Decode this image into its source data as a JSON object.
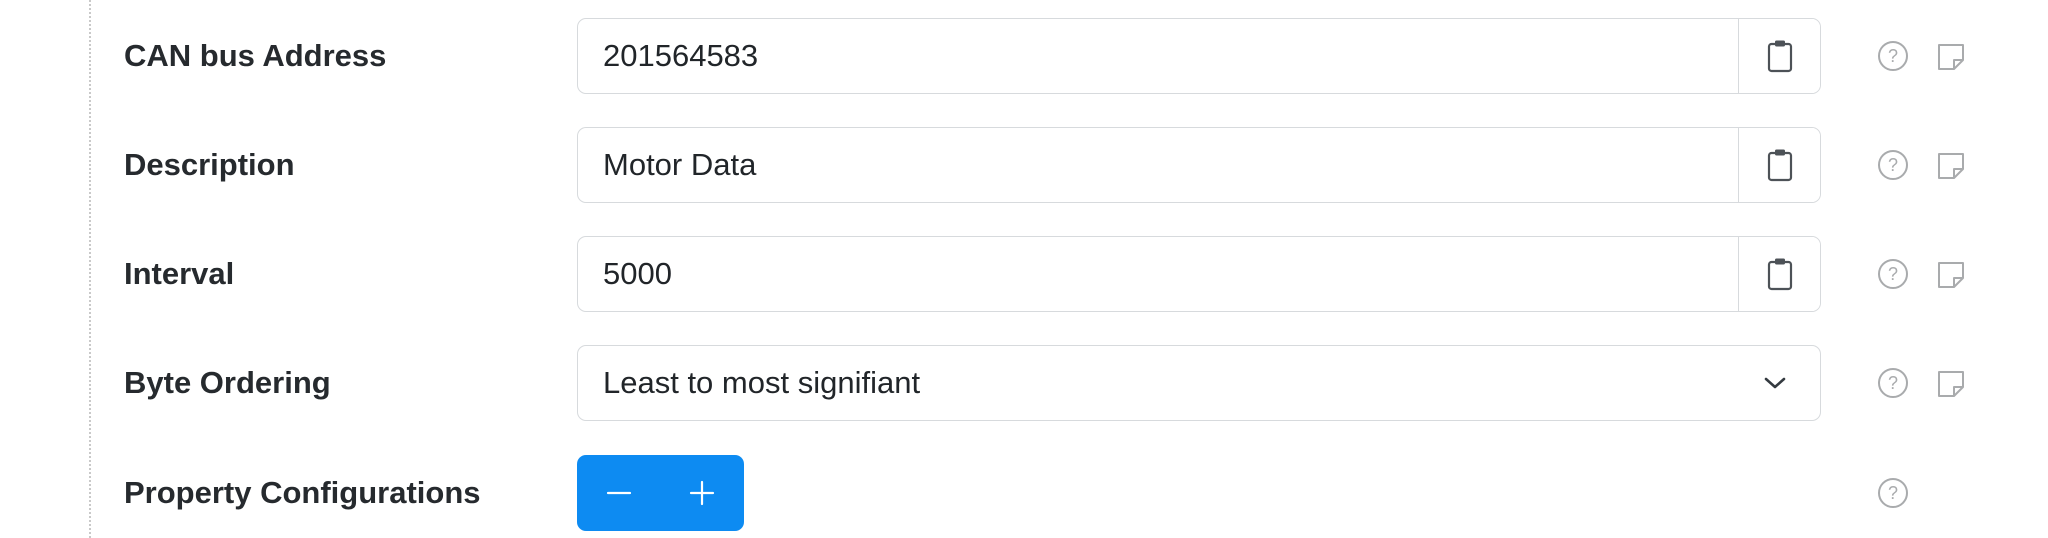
{
  "form": {
    "fields": [
      {
        "label": "CAN bus Address",
        "value": "201564583",
        "control": "text-with-clipboard"
      },
      {
        "label": "Description",
        "value": "Motor Data",
        "control": "text-with-clipboard"
      },
      {
        "label": "Interval",
        "value": "5000",
        "control": "text-with-clipboard"
      },
      {
        "label": "Byte Ordering",
        "value": "Least to most signifiant",
        "control": "select"
      },
      {
        "label": "Property Configurations",
        "control": "stepper"
      }
    ],
    "icons": {
      "clipboard": "clipboard-icon",
      "help": "help-circle-icon",
      "note": "sticky-note-icon",
      "chevron": "chevron-down-icon",
      "minus": "minus-icon",
      "plus": "plus-icon"
    },
    "colors": {
      "accent": "#0d8bf2",
      "label_text": "#262a2e",
      "border": "#d7dadd",
      "icon_gray": "#a9abad"
    }
  }
}
